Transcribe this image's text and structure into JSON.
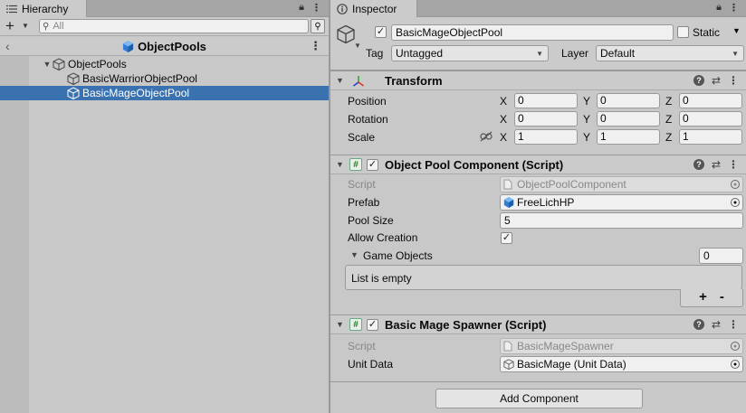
{
  "hierarchy": {
    "tab_label": "Hierarchy",
    "search_placeholder": "All",
    "scene_title": "ObjectPools",
    "items": [
      {
        "label": "ObjectPools",
        "selected": false
      },
      {
        "label": "BasicWarriorObjectPool",
        "selected": false
      },
      {
        "label": "BasicMageObjectPool",
        "selected": true
      }
    ]
  },
  "inspector": {
    "tab_label": "Inspector",
    "object_name": "BasicMageObjectPool",
    "static_label": "Static",
    "tag_label": "Tag",
    "tag_value": "Untagged",
    "layer_label": "Layer",
    "layer_value": "Default",
    "transform": {
      "title": "Transform",
      "rows": [
        {
          "label": "Position",
          "x": "0",
          "y": "0",
          "z": "0"
        },
        {
          "label": "Rotation",
          "x": "0",
          "y": "0",
          "z": "0"
        },
        {
          "label": "Scale",
          "x": "1",
          "y": "1",
          "z": "1"
        }
      ],
      "axis_x": "X",
      "axis_y": "Y",
      "axis_z": "Z"
    },
    "pool_component": {
      "title": "Object Pool Component (Script)",
      "script_label": "Script",
      "script_value": "ObjectPoolComponent",
      "prefab_label": "Prefab",
      "prefab_value": "FreeLichHP",
      "pool_size_label": "Pool Size",
      "pool_size_value": "5",
      "allow_creation_label": "Allow Creation",
      "game_objects_label": "Game Objects",
      "game_objects_count": "0",
      "list_empty": "List is empty",
      "plus": "+",
      "minus": "-"
    },
    "spawner": {
      "title": "Basic Mage Spawner (Script)",
      "script_label": "Script",
      "script_value": "BasicMageSpawner",
      "unit_data_label": "Unit Data",
      "unit_data_value": "BasicMage (Unit Data)"
    },
    "add_component": "Add Component"
  },
  "colors": {
    "selection": "#3a72b0",
    "panel": "#c8c8c8",
    "tab_bar": "#a5a5a5"
  }
}
